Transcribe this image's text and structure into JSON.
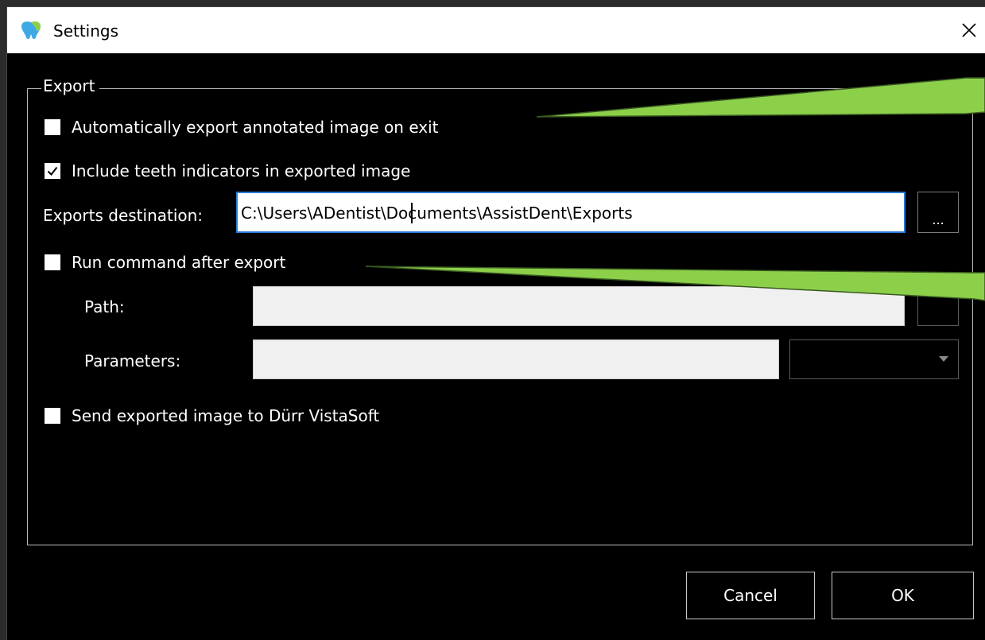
{
  "window": {
    "title": "Settings",
    "close_glyph": "✕"
  },
  "export_group": {
    "label": "Export",
    "auto_export": {
      "label": "Automatically export annotated image on exit",
      "checked": false
    },
    "include_teeth": {
      "label": "Include teeth indicators in exported image",
      "checked": true
    },
    "destination": {
      "label": "Exports destination:",
      "value": "C:\\Users\\ADentist\\Documents\\AssistDent\\Exports",
      "browse_label": "..."
    },
    "run_command": {
      "label": "Run command after export",
      "checked": false,
      "path_label": "Path:",
      "path_value": "",
      "parameters_label": "Parameters:",
      "parameters_value": "",
      "parameters_option": ""
    },
    "send_vistasoft": {
      "label": "Send exported image to Dürr VistaSoft",
      "checked": false
    }
  },
  "buttons": {
    "cancel": "Cancel",
    "ok": "OK"
  },
  "icons": {
    "app": "app-logo-icon",
    "close": "close-icon",
    "check": "checkmark-icon",
    "dropdown": "chevron-down-icon"
  },
  "colors": {
    "titlebar_bg": "#ffffff",
    "dialog_bg": "#000000",
    "input_focus_border": "#2a7bd6",
    "annotation_fill": "#8cd04a"
  }
}
